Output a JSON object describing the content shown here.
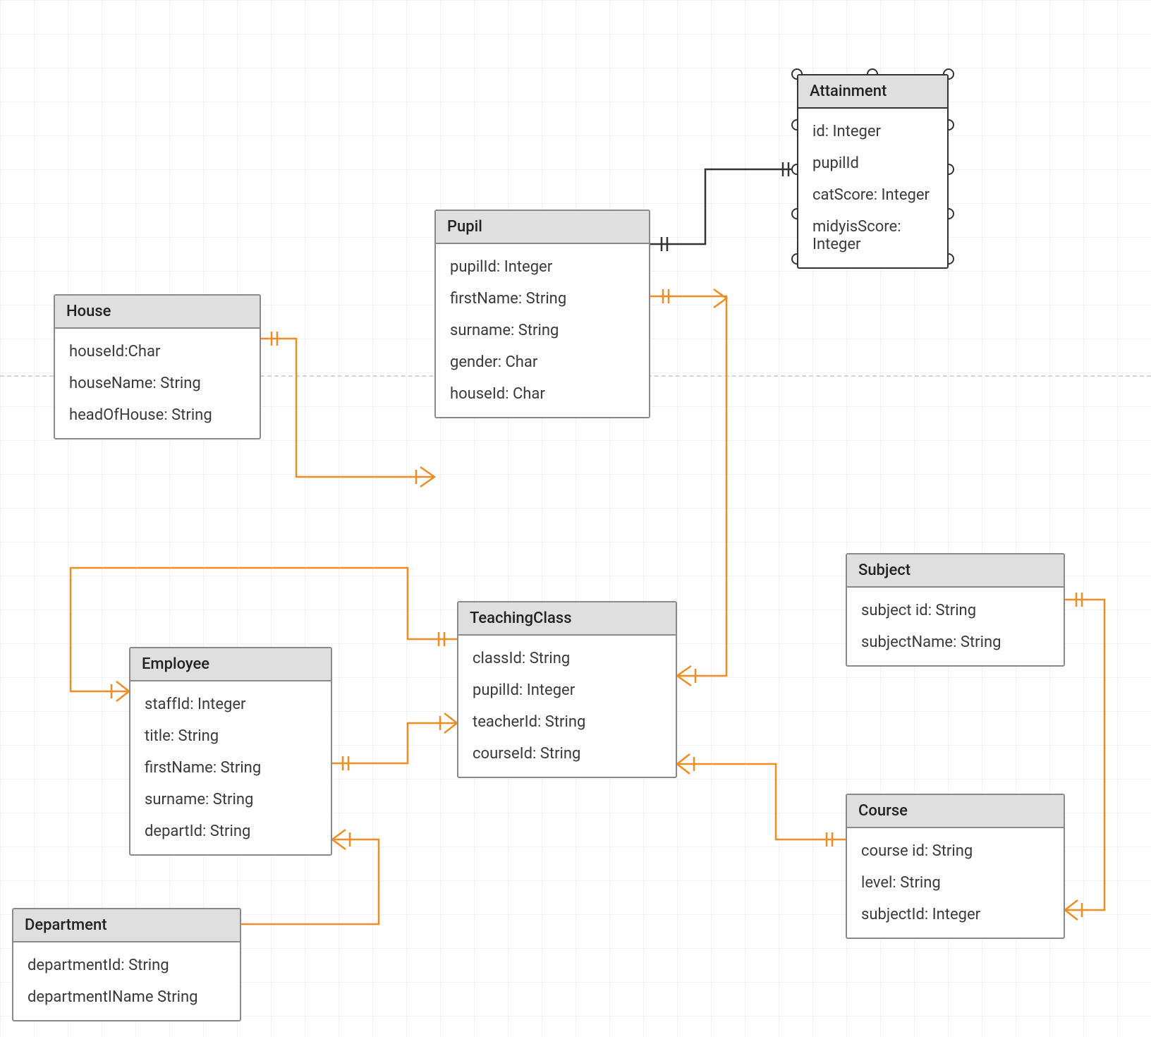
{
  "entities": {
    "house": {
      "title": "House",
      "fields": [
        "houseId:Char",
        "houseName: String",
        "headOfHouse: String"
      ]
    },
    "pupil": {
      "title": "Pupil",
      "fields": [
        "pupilId: Integer",
        "firstName: String",
        "surname: String",
        "gender: Char",
        "houseId: Char"
      ]
    },
    "attainment": {
      "title": "Attainment",
      "fields": [
        "id: Integer",
        "pupilId",
        "catScore: Integer",
        "midyisScore: Integer"
      ]
    },
    "employee": {
      "title": "Employee",
      "fields": [
        "staffId: Integer",
        "title: String",
        "firstName: String",
        "surname: String",
        "departId: String"
      ]
    },
    "teachingClass": {
      "title": "TeachingClass",
      "fields": [
        "classId: String",
        "pupilId: Integer",
        "teacherId: String",
        "courseId: String"
      ]
    },
    "subject": {
      "title": "Subject",
      "fields": [
        "subject id: String",
        "subjectName: String"
      ]
    },
    "course": {
      "title": "Course",
      "fields": [
        "course id: String",
        "level: String",
        "subjectId: Integer"
      ]
    },
    "department": {
      "title": "Department",
      "fields": [
        "departmentId: String",
        "departmentIName String"
      ]
    }
  }
}
